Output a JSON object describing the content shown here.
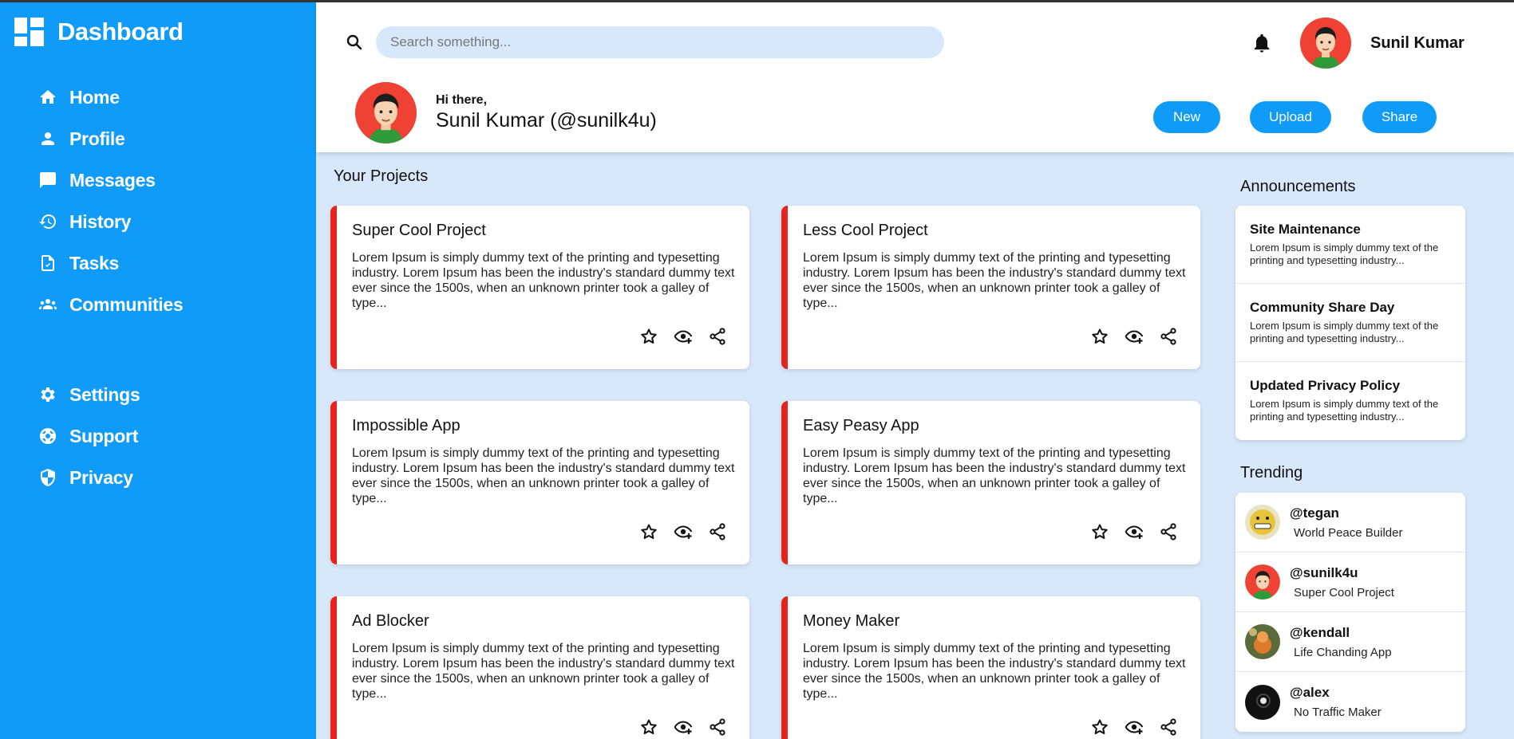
{
  "sidebar": {
    "brand": "Dashboard",
    "primary": [
      {
        "label": "Home",
        "icon": "home-icon"
      },
      {
        "label": "Profile",
        "icon": "person-icon"
      },
      {
        "label": "Messages",
        "icon": "chat-icon"
      },
      {
        "label": "History",
        "icon": "history-icon"
      },
      {
        "label": "Tasks",
        "icon": "document-icon"
      },
      {
        "label": "Communities",
        "icon": "people-icon"
      }
    ],
    "secondary": [
      {
        "label": "Settings",
        "icon": "gear-icon"
      },
      {
        "label": "Support",
        "icon": "lifebuoy-icon"
      },
      {
        "label": "Privacy",
        "icon": "shield-icon"
      }
    ]
  },
  "header": {
    "search_placeholder": "Search something...",
    "user_name": "Sunil Kumar",
    "greeting_small": "Hi there,",
    "greeting_big": "Sunil Kumar (@sunilk4u)",
    "buttons": {
      "new": "New",
      "upload": "Upload",
      "share": "Share"
    }
  },
  "projects": {
    "title": "Your Projects",
    "items": [
      {
        "title": "Super Cool Project",
        "text": "Lorem Ipsum is simply dummy text of the printing and typesetting industry. Lorem Ipsum has been the industry's standard dummy text ever since the 1500s, when an unknown printer took a galley of type..."
      },
      {
        "title": "Less Cool Project",
        "text": "Lorem Ipsum is simply dummy text of the printing and typesetting industry. Lorem Ipsum has been the industry's standard dummy text ever since the 1500s, when an unknown printer took a galley of type..."
      },
      {
        "title": "Impossible App",
        "text": "Lorem Ipsum is simply dummy text of the printing and typesetting industry. Lorem Ipsum has been the industry's standard dummy text ever since the 1500s, when an unknown printer took a galley of type..."
      },
      {
        "title": "Easy Peasy App",
        "text": "Lorem Ipsum is simply dummy text of the printing and typesetting industry. Lorem Ipsum has been the industry's standard dummy text ever since the 1500s, when an unknown printer took a galley of type..."
      },
      {
        "title": "Ad Blocker",
        "text": "Lorem Ipsum is simply dummy text of the printing and typesetting industry. Lorem Ipsum has been the industry's standard dummy text ever since the 1500s, when an unknown printer took a galley of type..."
      },
      {
        "title": "Money Maker",
        "text": "Lorem Ipsum is simply dummy text of the printing and typesetting industry. Lorem Ipsum has been the industry's standard dummy text ever since the 1500s, when an unknown printer took a galley of type..."
      }
    ]
  },
  "announcements": {
    "title": "Announcements",
    "items": [
      {
        "title": "Site Maintenance",
        "text": "Lorem Ipsum is simply dummy text of the printing and typesetting industry..."
      },
      {
        "title": "Community Share Day",
        "text": "Lorem Ipsum is simply dummy text of the printing and typesetting industry..."
      },
      {
        "title": "Updated Privacy Policy",
        "text": "Lorem Ipsum is simply dummy text of the printing and typesetting industry..."
      }
    ]
  },
  "trending": {
    "title": "Trending",
    "items": [
      {
        "handle": "@tegan",
        "project": "World Peace Builder"
      },
      {
        "handle": "@sunilk4u",
        "project": "Super Cool Project"
      },
      {
        "handle": "@kendall",
        "project": "Life Chanding App"
      },
      {
        "handle": "@alex",
        "project": "No Traffic Maker"
      }
    ]
  },
  "colors": {
    "accent": "#0f9bf7",
    "card_border": "#e5231b",
    "page_bg": "#d8e8fb"
  }
}
